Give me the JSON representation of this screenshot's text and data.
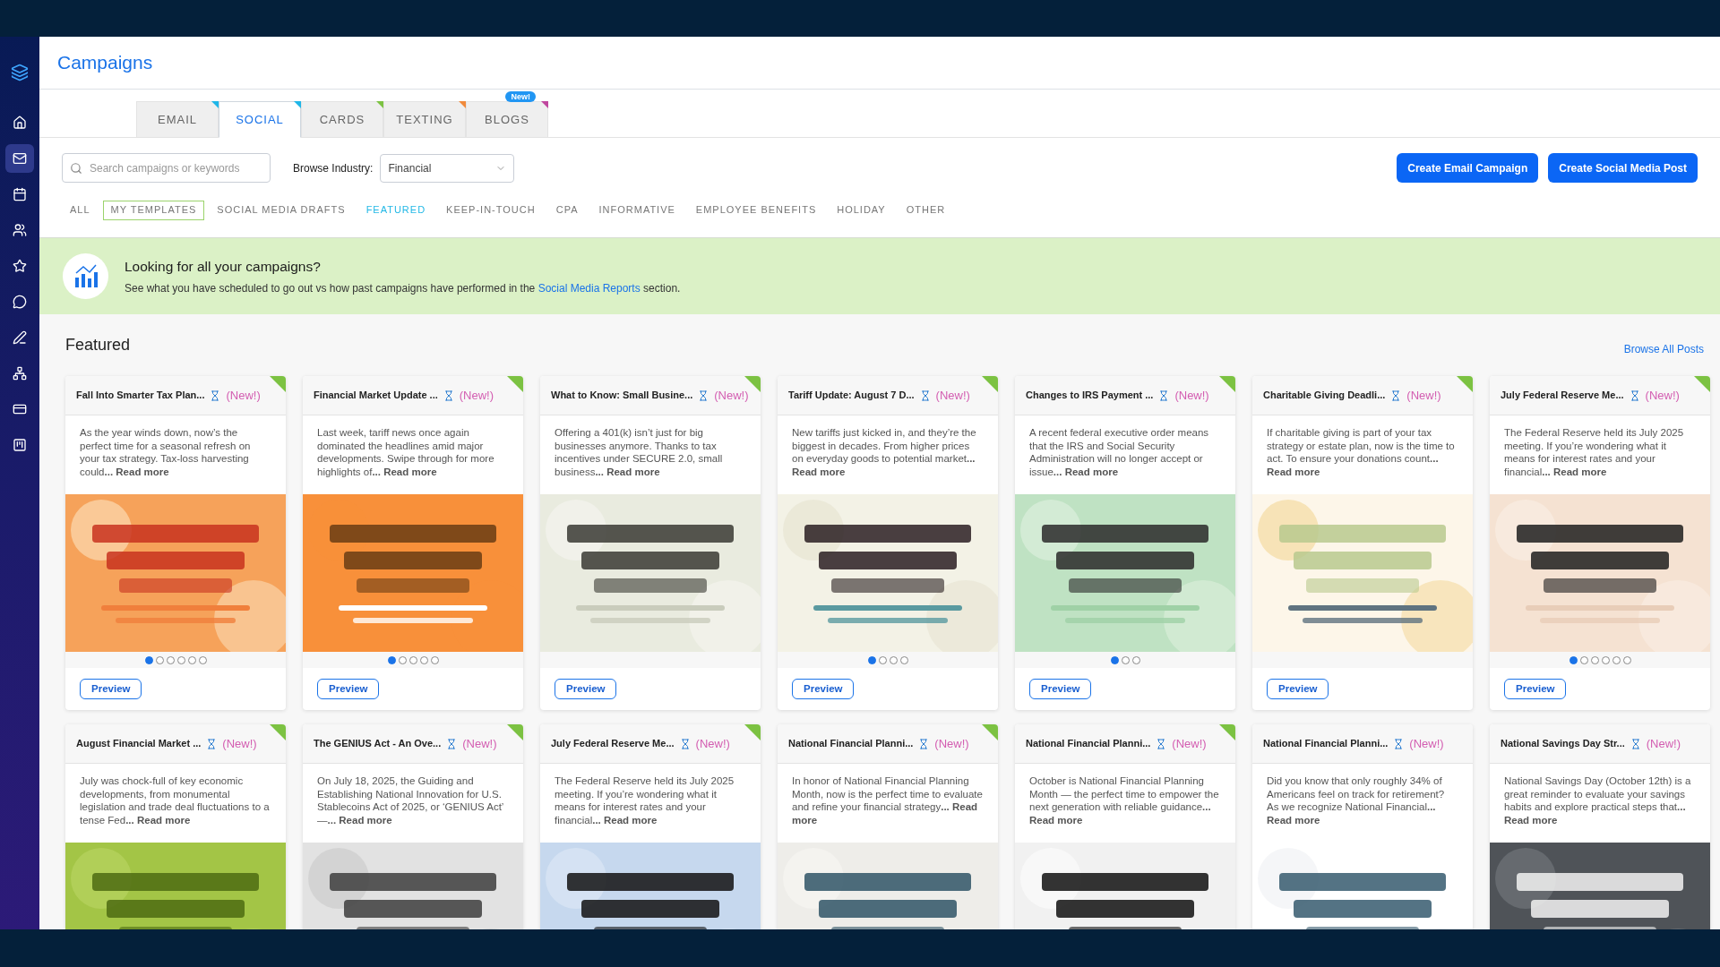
{
  "page_title": "Campaigns",
  "sidebar": {
    "items": [
      {
        "selected": false
      },
      {
        "selected": true
      },
      {
        "selected": false
      },
      {
        "selected": false
      },
      {
        "selected": false
      },
      {
        "selected": false
      },
      {
        "selected": false
      },
      {
        "selected": false
      },
      {
        "selected": false
      },
      {
        "selected": false
      }
    ]
  },
  "tabs": [
    {
      "label": "EMAIL",
      "selected": false,
      "color": "#1fb6e8"
    },
    {
      "label": "SOCIAL",
      "selected": true,
      "color": "#1fb6e8"
    },
    {
      "label": "CARDS",
      "selected": false,
      "color": "#7cc242"
    },
    {
      "label": "TEXTING",
      "selected": false,
      "color": "#f08a3c"
    },
    {
      "label": "BLOGS",
      "selected": false,
      "color": "#c0479e",
      "badge": "New!"
    }
  ],
  "search": {
    "placeholder": "Search campaigns or keywords"
  },
  "industry": {
    "label": "Browse Industry:",
    "value": "Financial"
  },
  "buttons": [
    "Create Email Campaign",
    "Create Social Media Post"
  ],
  "filters": [
    {
      "label": "ALL",
      "selected": false,
      "outlined": false
    },
    {
      "label": "MY TEMPLATES",
      "selected": false,
      "outlined": true
    },
    {
      "label": "SOCIAL MEDIA DRAFTS",
      "selected": false,
      "outlined": false
    },
    {
      "label": "FEATURED",
      "selected": true,
      "outlined": false
    },
    {
      "label": "KEEP-IN-TOUCH",
      "selected": false,
      "outlined": false
    },
    {
      "label": "CPA",
      "selected": false,
      "outlined": false
    },
    {
      "label": "INFORMATIVE",
      "selected": false,
      "outlined": false
    },
    {
      "label": "EMPLOYEE BENEFITS",
      "selected": false,
      "outlined": false
    },
    {
      "label": "HOLIDAY",
      "selected": false,
      "outlined": false
    },
    {
      "label": "OTHER",
      "selected": false,
      "outlined": false
    }
  ],
  "banner": {
    "title": "Looking for all your campaigns?",
    "text": "See what you have scheduled to go out vs how past campaigns have performed in the",
    "link": "Social Media Reports",
    "text_after": "section."
  },
  "section": {
    "title": "Featured",
    "link": "Browse All Posts"
  },
  "cards": [
    {
      "title": "Fall Into Smarter Tax Plan...",
      "new_label": "(New!)",
      "flagged": true,
      "description": "As the year winds down, now’s the perfect time for a seasonal refresh on your tax strategy. Tax-loss harvesting could**... Read more**",
      "dots": [
        {
          "selected": true
        },
        {
          "selected": false
        },
        {
          "selected": false
        },
        {
          "selected": false
        },
        {
          "selected": false
        },
        {
          "selected": false
        }
      ],
      "preview": "Preview"
    },
    {
      "title": "Financial Market Update ...",
      "new_label": "(New!)",
      "flagged": true,
      "description": "Last week, tariff news once again dominated the headlines amid major developments. Swipe through for more highlights of**... Read more**",
      "dots": [
        {
          "selected": true
        },
        {
          "selected": false
        },
        {
          "selected": false
        },
        {
          "selected": false
        },
        {
          "selected": false
        }
      ],
      "preview": "Preview"
    },
    {
      "title": "What to Know: Small Busine...",
      "new_label": "(New!)",
      "flagged": true,
      "description": "Offering a 401(k) isn’t just for big businesses anymore. Thanks to tax incentives under SECURE 2.0, small business**... Read more**",
      "preview": "Preview"
    },
    {
      "title": "Tariff Update: August 7 D...",
      "new_label": "(New!)",
      "flagged": true,
      "description": "New tariffs just kicked in, and they’re the biggest in decades. From higher prices on everyday goods to potential market**... Read more**",
      "dots": [
        {
          "selected": true
        },
        {
          "selected": false
        },
        {
          "selected": false
        },
        {
          "selected": false
        }
      ],
      "preview": "Preview"
    },
    {
      "title": "Changes to IRS Payment ...",
      "new_label": "(New!)",
      "flagged": true,
      "description": "A recent federal executive order means that the IRS and Social Security Administration will no longer accept or issue**... Read more**",
      "dots": [
        {
          "selected": true
        },
        {
          "selected": false
        },
        {
          "selected": false
        }
      ],
      "preview": "Preview"
    },
    {
      "title": "Charitable Giving Deadli...",
      "new_label": "(New!)",
      "flagged": true,
      "description": "If charitable giving is part of your tax strategy or estate plan, now is the time to act. To ensure your donations count**... Read more**",
      "preview": "Preview"
    },
    {
      "title": "July Federal Reserve Me...",
      "new_label": "(New!)",
      "flagged": true,
      "description": "The Federal Reserve held its July 2025 meeting. If you’re wondering what it means for interest rates and your financial**... Read more**",
      "dots": [
        {
          "selected": true
        },
        {
          "selected": false
        },
        {
          "selected": false
        },
        {
          "selected": false
        },
        {
          "selected": false
        },
        {
          "selected": false
        }
      ],
      "preview": "Preview"
    },
    {
      "title": "August Financial Market ...",
      "new_label": "(New!)",
      "flagged": true,
      "description": "July was chock-full of key economic developments, from monumental legislation and trade deal fluctuations to a tense Fed**... Read more**"
    },
    {
      "title": "The GENIUS Act - An Ove...",
      "new_label": "(New!)",
      "flagged": true,
      "description": "On July 18, 2025, the Guiding and Establishing National Innovation for U.S. Stablecoins Act of 2025, or ‘GENIUS Act’ —**... Read more**"
    },
    {
      "title": "July Federal Reserve Me...",
      "new_label": "(New!)",
      "flagged": true,
      "description": "The Federal Reserve held its July 2025 meeting. If you’re wondering what it means for interest rates and your financial**... Read more**"
    },
    {
      "title": "National Financial Planni...",
      "new_label": "(New!)",
      "flagged": true,
      "description": "In honor of National Financial Planning Month, now is the perfect time to evaluate and refine your financial strategy**... Read more**"
    },
    {
      "title": "National Financial Planni...",
      "new_label": "(New!)",
      "flagged": true,
      "description": "October is National Financial Planning Month — the perfect time to empower the next generation with reliable guidance**... Read more**"
    },
    {
      "title": "National Financial Planni...",
      "new_label": "(New!)",
      "flagged": false,
      "description": "Did you know that only roughly 34% of Americans feel on track for retirement? As we recognize National Financial**... Read more**"
    },
    {
      "title": "National Savings Day Str...",
      "new_label": "(New!)",
      "flagged": false,
      "description": "National Savings Day (October 12th) is a great reminder to evaluate your savings habits and explore practical steps that**... Read more**"
    }
  ]
}
